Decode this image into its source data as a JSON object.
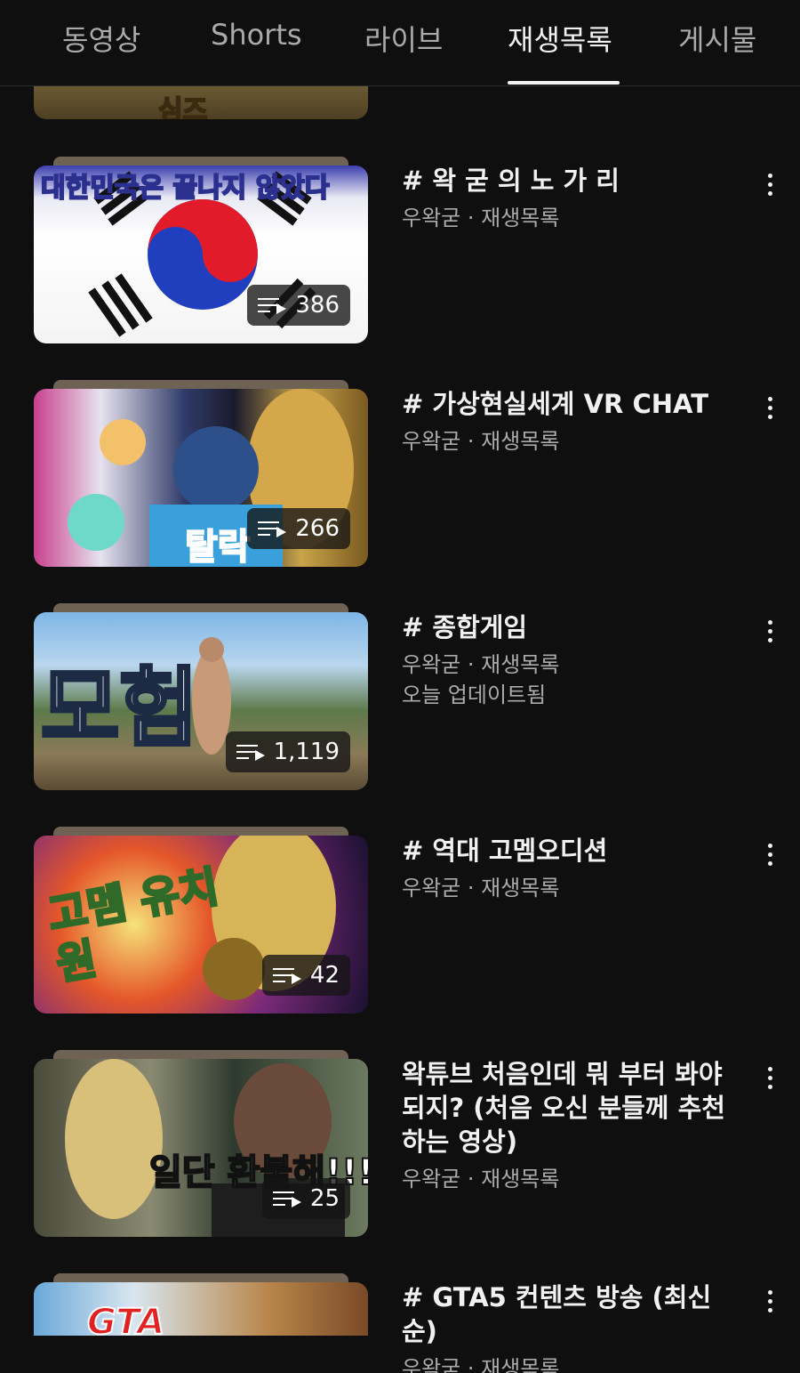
{
  "tabs": [
    {
      "label": "동영상"
    },
    {
      "label": "Shorts"
    },
    {
      "label": "라이브"
    },
    {
      "label": "재생목록"
    },
    {
      "label": "게시물"
    }
  ],
  "active_tab": "재생목록",
  "icons": {
    "playlist": "playlist-icon",
    "more": "more-vert-icon"
  },
  "colors": {
    "background": "#0f0f0f",
    "text": "#f1f1f1",
    "secondary": "#aaaaaa"
  },
  "partial_top_thumbnail": {
    "text": "심즈"
  },
  "playlists": [
    {
      "title": "# 왁 굳 의 노 가 리",
      "channel_line": "우왁굳 · 재생목록",
      "count": "386",
      "thumb_text": "대한민국은 끝나지 않았다"
    },
    {
      "title": "# 가상현실세계 VR CHAT",
      "channel_line": "우왁굳 · 재생목록",
      "count": "266",
      "thumb_text": "탈락"
    },
    {
      "title": "# 종합게임",
      "channel_line": "우왁굳 · 재생목록",
      "updated": "오늘 업데이트됨",
      "count": "1,119",
      "thumb_text": "모험"
    },
    {
      "title": "# 역대 고멤오디션",
      "channel_line": "우왁굳 · 재생목록",
      "count": "42",
      "thumb_text": "고멤 유치원"
    },
    {
      "title": "왁튜브 처음인데 뭐 부터 봐야되지? (처음 오신 분들께 추천하는 영상)",
      "channel_line": "우왁굳 · 재생목록",
      "count": "25",
      "thumb_text": "일단 환불해!!!"
    },
    {
      "title": "# GTA5 컨텐츠 방송 (최신순)",
      "channel_line": "우왁굳 · 재생목록",
      "thumb_text": "GTA"
    }
  ]
}
